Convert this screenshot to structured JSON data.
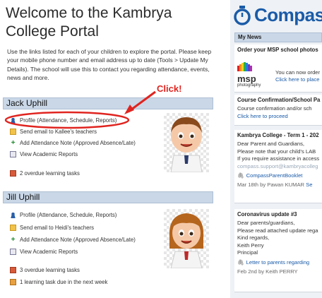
{
  "welcome": {
    "title": "Welcome to the Kambrya College Portal",
    "intro": "Use the links listed for each of your children to explore the portal. Please keep your mobile phone number and email address up to date (Tools > Update My Details). The school will use this to contact you regarding attendance, events, news and more."
  },
  "annotation": {
    "label": "Click!",
    "color": "#e0241f"
  },
  "students": [
    {
      "name": "Jack Uphill",
      "links": {
        "profile": "Profile (Attendance, Schedule, Reports)",
        "email": "Send email to Kallee's teachers",
        "attendance": "Add Attendance Note (Approved Absence/Late)",
        "academic": "View Academic Reports"
      },
      "tasks": [
        "2 overdue learning tasks"
      ]
    },
    {
      "name": "Jill Uphill",
      "links": {
        "profile": "Profile (Attendance, Schedule, Reports)",
        "email": "Send email to Heidi's teachers",
        "attendance": "Add Attendance Note (Approved Absence/Late)",
        "academic": "View Academic Reports"
      },
      "tasks": [
        "3 overdue learning tasks",
        "1 learning task due in the next week"
      ]
    }
  ],
  "compass": {
    "brand": "Compass",
    "brand_color": "#1a5ba8",
    "news_header": "My News",
    "news": [
      {
        "title": "Order your MSP school photos",
        "logo_main": "msp",
        "logo_sub": "photography",
        "line1": "You can now order",
        "link": "Click here to place"
      },
      {
        "title": "Course Confirmation/School Pa",
        "line1": "Course confirmation and/or sch",
        "link": "Click here to proceed"
      },
      {
        "title": "Kambrya College - Term 1 - 202",
        "lines": [
          "Dear Parent and Guardians,",
          "Please note that your child's LAB",
          "If you require assistance in access",
          "compass.support@kambryacolleg"
        ],
        "attachment": "CompassParentBooklet",
        "date": "Mar 18th",
        "by": "by",
        "author": "Pawan KUMAR",
        "sep": "Se"
      },
      {
        "title": "Coronavirus update #3",
        "lines": [
          "Dear parents/guardians,",
          "Please read attached update rega",
          "Kind regards,",
          "Keith Perry",
          "Principal"
        ],
        "attachment": "Letter to parents regarding",
        "date": "Feb 2nd",
        "by": "by",
        "author": "Keith PERRY"
      }
    ]
  }
}
